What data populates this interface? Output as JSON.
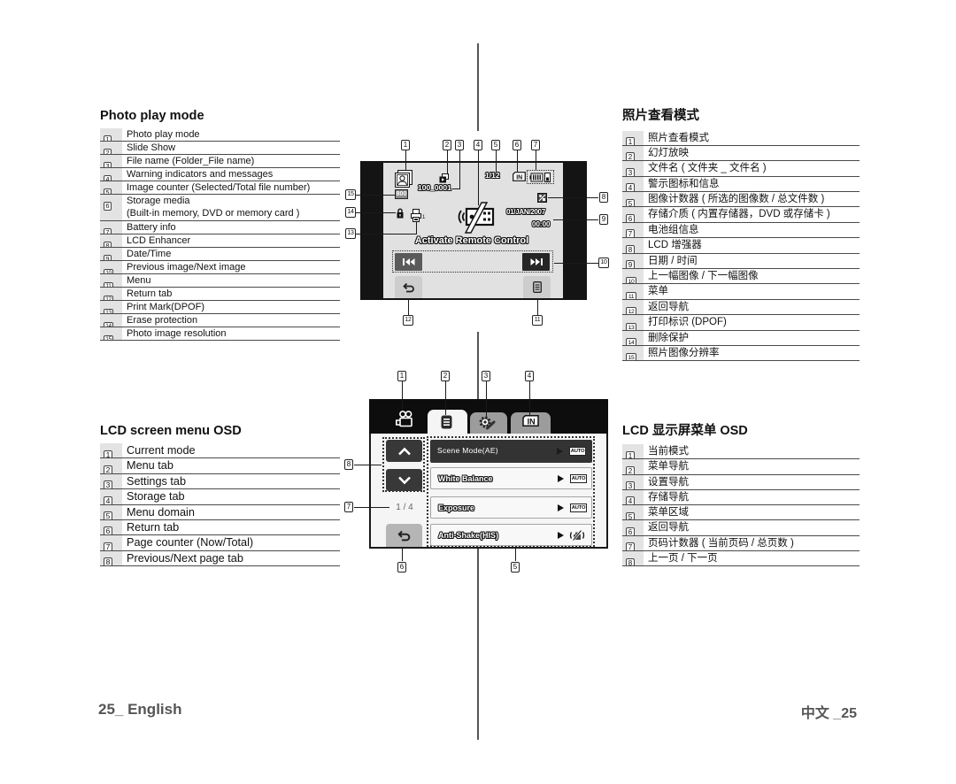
{
  "photo_play_mode": {
    "title": "Photo play mode",
    "items": [
      {
        "num": "1",
        "lines": [
          "Photo play mode"
        ]
      },
      {
        "num": "2",
        "lines": [
          "Slide Show"
        ]
      },
      {
        "num": "3",
        "lines": [
          "File name (Folder_File name)"
        ]
      },
      {
        "num": "4",
        "lines": [
          "Warning indicators and messages"
        ]
      },
      {
        "num": "5",
        "lines": [
          "Image counter (Selected/Total file number)"
        ]
      },
      {
        "num": "6",
        "lines": [
          "Storage media",
          "(Built-in memory, DVD or memory card )"
        ]
      },
      {
        "num": "7",
        "lines": [
          "Battery info"
        ]
      },
      {
        "num": "8",
        "lines": [
          "LCD Enhancer"
        ]
      },
      {
        "num": "9",
        "lines": [
          "Date/Time"
        ]
      },
      {
        "num": "10",
        "lines": [
          "Previous image/Next image"
        ]
      },
      {
        "num": "11",
        "lines": [
          "Menu"
        ]
      },
      {
        "num": "12",
        "lines": [
          "Return tab"
        ]
      },
      {
        "num": "13",
        "lines": [
          "Print Mark(DPOF)"
        ]
      },
      {
        "num": "14",
        "lines": [
          "Erase protection"
        ]
      },
      {
        "num": "15",
        "lines": [
          "Photo image resolution"
        ]
      }
    ]
  },
  "lcd_menu_osd": {
    "title": "LCD screen menu OSD",
    "items": [
      {
        "num": "1",
        "lines": [
          "Current mode"
        ]
      },
      {
        "num": "2",
        "lines": [
          "Menu tab"
        ]
      },
      {
        "num": "3",
        "lines": [
          "Settings tab"
        ]
      },
      {
        "num": "4",
        "lines": [
          "Storage tab"
        ]
      },
      {
        "num": "5",
        "lines": [
          "Menu domain"
        ]
      },
      {
        "num": "6",
        "lines": [
          "Return tab"
        ]
      },
      {
        "num": "7",
        "lines": [
          "Page counter (Now/Total)"
        ]
      },
      {
        "num": "8",
        "lines": [
          "Previous/Next page tab"
        ]
      }
    ]
  },
  "photo_play_mode_zh": {
    "title": "照片查看模式",
    "items": [
      {
        "num": "1",
        "lines": [
          "照片查看模式"
        ]
      },
      {
        "num": "2",
        "lines": [
          "幻灯放映"
        ]
      },
      {
        "num": "3",
        "lines": [
          "文件名 ( 文件夹 _ 文件名 )"
        ]
      },
      {
        "num": "4",
        "lines": [
          "警示图标和信息"
        ]
      },
      {
        "num": "5",
        "lines": [
          "图像计数器 ( 所选的图像数 / 总文件数 )"
        ]
      },
      {
        "num": "6",
        "lines": [
          "存储介质 ( 内置存储器，DVD 或存储卡 )"
        ]
      },
      {
        "num": "7",
        "lines": [
          "电池组信息"
        ]
      },
      {
        "num": "8",
        "lines": [
          "LCD 增强器"
        ]
      },
      {
        "num": "9",
        "lines": [
          "日期 / 时间"
        ]
      },
      {
        "num": "10",
        "lines": [
          "上一幅图像 / 下一幅图像"
        ]
      },
      {
        "num": "11",
        "lines": [
          "菜单"
        ]
      },
      {
        "num": "12",
        "lines": [
          "返回导航"
        ]
      },
      {
        "num": "13",
        "lines": [
          "打印标识 (DPOF)"
        ]
      },
      {
        "num": "14",
        "lines": [
          "删除保护"
        ]
      },
      {
        "num": "15",
        "lines": [
          "照片图像分辨率"
        ]
      }
    ]
  },
  "lcd_menu_osd_zh": {
    "title": "LCD 显示屏菜单 OSD",
    "items": [
      {
        "num": "1",
        "lines": [
          "当前模式"
        ]
      },
      {
        "num": "2",
        "lines": [
          "菜单导航"
        ]
      },
      {
        "num": "3",
        "lines": [
          "设置导航"
        ]
      },
      {
        "num": "4",
        "lines": [
          "存储导航"
        ]
      },
      {
        "num": "5",
        "lines": [
          "菜单区域"
        ]
      },
      {
        "num": "6",
        "lines": [
          "返回导航"
        ]
      },
      {
        "num": "7",
        "lines": [
          "页码计数器 ( 当前页码 / 总页数 )"
        ]
      },
      {
        "num": "8",
        "lines": [
          "上一页 / 下一页"
        ]
      }
    ]
  },
  "photo_screen": {
    "callouts": [
      "1",
      "2",
      "3",
      "4",
      "5",
      "6",
      "7",
      "8",
      "9",
      "10",
      "11",
      "12",
      "13",
      "14",
      "15"
    ],
    "file_name": "100_0001",
    "image_counter": "1/12",
    "storage_media": "IN",
    "resolution": "800",
    "print_count": "1",
    "date": "01/JAN/2007",
    "time": "00:00",
    "message": "Activate Remote Control",
    "icons": {
      "mode": "photo-play-mode-icon",
      "slide_show": "slide-show-icon",
      "warning": "remote-control-disabled-icon",
      "battery": "battery-icon",
      "lcd_enhancer": "lcd-enhancer-icon",
      "protect": "lock-icon",
      "print_mark": "printer-icon",
      "previous": "previous-image-icon",
      "next": "next-image-icon",
      "return": "return-arrow-icon",
      "menu": "menu-icon"
    }
  },
  "menu_screen": {
    "callouts": [
      "1",
      "2",
      "3",
      "4",
      "5",
      "6",
      "7",
      "8"
    ],
    "tabs": [
      {
        "name": "current-mode",
        "icon": "camcorder-icon"
      },
      {
        "name": "menu",
        "icon": "menu-list-icon",
        "active": true
      },
      {
        "name": "settings",
        "icon": "settings-gear-icon"
      },
      {
        "name": "storage",
        "icon": "storage-in-icon"
      }
    ],
    "storage_tab_label": "IN",
    "page_counter": "1 / 4",
    "items": [
      {
        "label": "Scene Mode(AE)",
        "value": "AUTO",
        "selected": true
      },
      {
        "label": "White Balance",
        "value": "AUTO"
      },
      {
        "label": "Exposure",
        "value": "AUTO"
      },
      {
        "label": "Anti-Shake(HIS)",
        "value_icon": "anti-shake-off-icon"
      }
    ]
  },
  "footer": {
    "left": "25_ English",
    "right": "中文 _25"
  }
}
